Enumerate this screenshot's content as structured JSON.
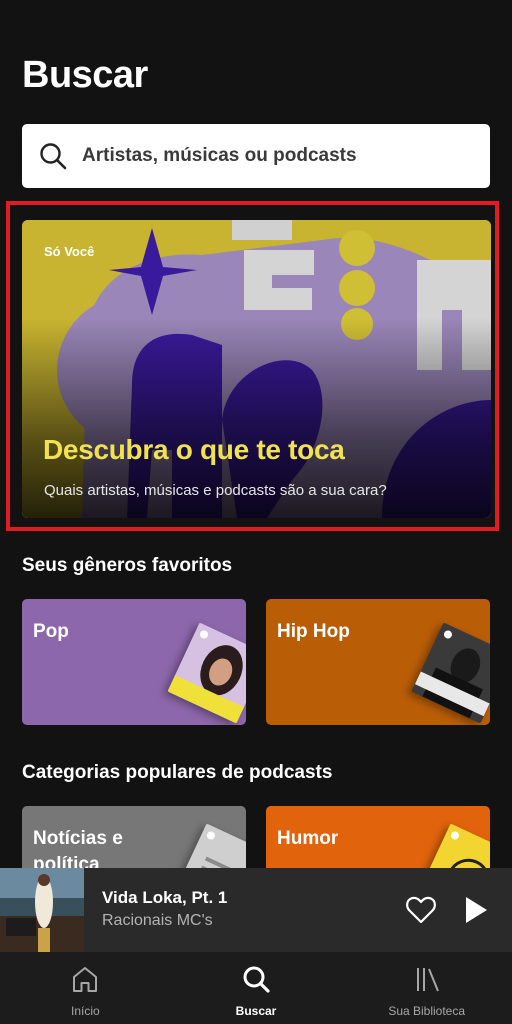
{
  "header": {
    "title": "Buscar"
  },
  "search": {
    "placeholder": "Artistas, músicas ou podcasts"
  },
  "promo": {
    "tag": "Só Você",
    "title": "Descubra o que te toca",
    "subtitle": "Quais artistas, músicas e podcasts são a sua cara?"
  },
  "favorite_genres": {
    "title": "Seus gêneros favoritos",
    "tiles": [
      {
        "label": "Pop",
        "color": "#8d67ab"
      },
      {
        "label": "Hip Hop",
        "color": "#ba5d07"
      }
    ]
  },
  "podcast_categories": {
    "title": "Categorias populares de podcasts",
    "tiles": [
      {
        "label": "Notícias e política",
        "color": "#777777"
      },
      {
        "label": "Humor",
        "color": "#e1640d"
      }
    ]
  },
  "now_playing": {
    "title": "Vida Loka, Pt. 1",
    "artist": "Racionais MC's",
    "actions": [
      "heart-icon",
      "play-icon"
    ]
  },
  "nav": {
    "items": [
      {
        "label": "Início",
        "icon": "home-icon",
        "active": false
      },
      {
        "label": "Buscar",
        "icon": "search-icon",
        "active": true
      },
      {
        "label": "Sua Biblioteca",
        "icon": "library-icon",
        "active": false
      }
    ]
  },
  "colors": {
    "background": "#121212",
    "accent_yellow": "#f1e34f",
    "highlight_red": "#e01b24"
  }
}
